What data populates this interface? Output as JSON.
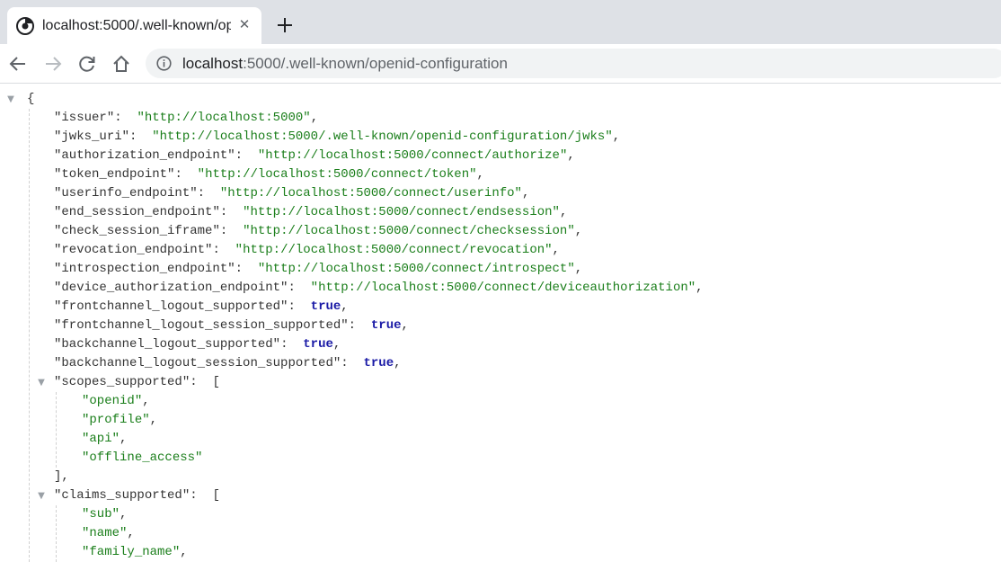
{
  "browser": {
    "tab": {
      "title": "localhost:5000/.well-known/op",
      "favicon": "chrome-favicon",
      "close_label": "✕"
    },
    "new_tab_label": "+",
    "address": {
      "host": "localhost",
      "rest": ":5000/.well-known/openid-configuration"
    },
    "icons": [
      "back-icon",
      "forward-icon",
      "reload-icon",
      "home-icon",
      "info-icon"
    ]
  },
  "json": {
    "open_brace": "{",
    "props": [
      {
        "key": "issuer",
        "type": "string",
        "value": "http://localhost:5000"
      },
      {
        "key": "jwks_uri",
        "type": "string",
        "value": "http://localhost:5000/.well-known/openid-configuration/jwks"
      },
      {
        "key": "authorization_endpoint",
        "type": "string",
        "value": "http://localhost:5000/connect/authorize"
      },
      {
        "key": "token_endpoint",
        "type": "string",
        "value": "http://localhost:5000/connect/token"
      },
      {
        "key": "userinfo_endpoint",
        "type": "string",
        "value": "http://localhost:5000/connect/userinfo"
      },
      {
        "key": "end_session_endpoint",
        "type": "string",
        "value": "http://localhost:5000/connect/endsession"
      },
      {
        "key": "check_session_iframe",
        "type": "string",
        "value": "http://localhost:5000/connect/checksession"
      },
      {
        "key": "revocation_endpoint",
        "type": "string",
        "value": "http://localhost:5000/connect/revocation"
      },
      {
        "key": "introspection_endpoint",
        "type": "string",
        "value": "http://localhost:5000/connect/introspect"
      },
      {
        "key": "device_authorization_endpoint",
        "type": "string",
        "value": "http://localhost:5000/connect/deviceauthorization"
      },
      {
        "key": "frontchannel_logout_supported",
        "type": "bool",
        "value": "true"
      },
      {
        "key": "frontchannel_logout_session_supported",
        "type": "bool",
        "value": "true"
      },
      {
        "key": "backchannel_logout_supported",
        "type": "bool",
        "value": "true"
      },
      {
        "key": "backchannel_logout_session_supported",
        "type": "bool",
        "value": "true"
      },
      {
        "key": "scopes_supported",
        "type": "array",
        "items": [
          "openid",
          "profile",
          "api",
          "offline_access"
        ],
        "closed": true
      },
      {
        "key": "claims_supported",
        "type": "array",
        "items": [
          "sub",
          "name",
          "family_name"
        ],
        "closed": false
      }
    ]
  },
  "colors": {
    "key": "#333333",
    "string": "#1a7e1a",
    "bool": "#1a1aa6",
    "toggle": "#9aa0a6"
  }
}
